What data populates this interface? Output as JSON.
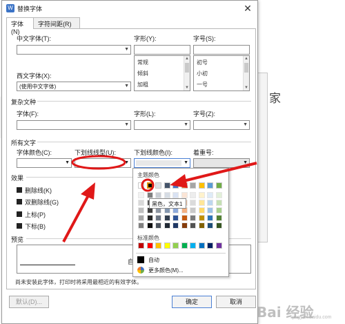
{
  "background": {
    "right_text": "家"
  },
  "dialog": {
    "title": "替换字体",
    "tabs": [
      "字体(N)",
      "字符间距(R)"
    ],
    "chinese_font": {
      "label": "中文字体(T):",
      "value": ""
    },
    "western_font": {
      "label": "西文字体(X):",
      "value": "(使用中文字体)"
    },
    "style": {
      "label": "字形(Y):",
      "value": "",
      "options": [
        "常规",
        "倾斜",
        "加粗"
      ]
    },
    "size": {
      "label": "字号(S):",
      "value": "",
      "options": [
        "初号",
        "小初",
        "一号"
      ]
    },
    "complex": {
      "section": "复杂文种",
      "font_label": "字体(F):",
      "style_label": "字形(L):",
      "size_label": "字号(Z):"
    },
    "all_text": {
      "section": "所有文字",
      "font_color_label": "字体颜色(C):",
      "underline_type_label": "下划线线型(U):",
      "underline_color_label": "下划线颜色(I):",
      "emphasis_label": "着重号:"
    },
    "effects": {
      "section": "效果",
      "items": [
        "删除线(K)",
        "双删除线(G)",
        "上标(P)",
        "下标(B)"
      ]
    },
    "preview": {
      "section": "预览",
      "sample": "自"
    },
    "note": "尚未安装此字体，打印时将采用最相近的有效字体。",
    "buttons": {
      "default": "默认(D)...",
      "ok": "确定",
      "cancel": "取消"
    }
  },
  "color_panel": {
    "theme_title": "主题颜色",
    "standard_title": "标准颜色",
    "tooltip": "黑色，文本1",
    "auto_label": "自动",
    "more_label": "更多颜色(M)...",
    "theme_top_row": [
      "#ffffff",
      "#000000",
      "#dde1e6",
      "#44546a",
      "#4472c4",
      "#ed7d31",
      "#a5a5a5",
      "#ffc000",
      "#5b9bd5",
      "#70ad47"
    ],
    "theme_shade_columns": [
      [
        "#f2f2f2",
        "#d9d9d9",
        "#bfbfbf",
        "#a6a6a6",
        "#808080"
      ],
      [
        "#7f7f7f",
        "#595959",
        "#404040",
        "#262626",
        "#0d0d0d"
      ],
      [
        "#c9cdd3",
        "#aeb4bc",
        "#8e96a2",
        "#6d7683",
        "#4b525c"
      ],
      [
        "#d6dce4",
        "#adb9ca",
        "#8497b0",
        "#333f50",
        "#222a35"
      ],
      [
        "#d9e2f3",
        "#b4c6e7",
        "#8eaadb",
        "#2f5496",
        "#1f3864"
      ],
      [
        "#fbe5d6",
        "#f8cbad",
        "#f4b183",
        "#c55a11",
        "#843c0c"
      ],
      [
        "#ededed",
        "#dbdbdb",
        "#c9c9c9",
        "#7b7b7b",
        "#525252"
      ],
      [
        "#fff2cc",
        "#ffe699",
        "#ffd966",
        "#bf9000",
        "#7f6000"
      ],
      [
        "#deebf7",
        "#bdd7ee",
        "#9dc3e6",
        "#2e75b6",
        "#1f4e79"
      ],
      [
        "#e2f0d9",
        "#c5e0b4",
        "#a9d18e",
        "#538135",
        "#375623"
      ]
    ],
    "standard_colors": [
      "#c00000",
      "#ff0000",
      "#ffc000",
      "#ffff00",
      "#92d050",
      "#00b050",
      "#00b0f0",
      "#0070c0",
      "#002060",
      "#7030a0"
    ]
  },
  "watermark": {
    "text": "Bai 经验",
    "sub": "jingyan.baidu.com"
  }
}
